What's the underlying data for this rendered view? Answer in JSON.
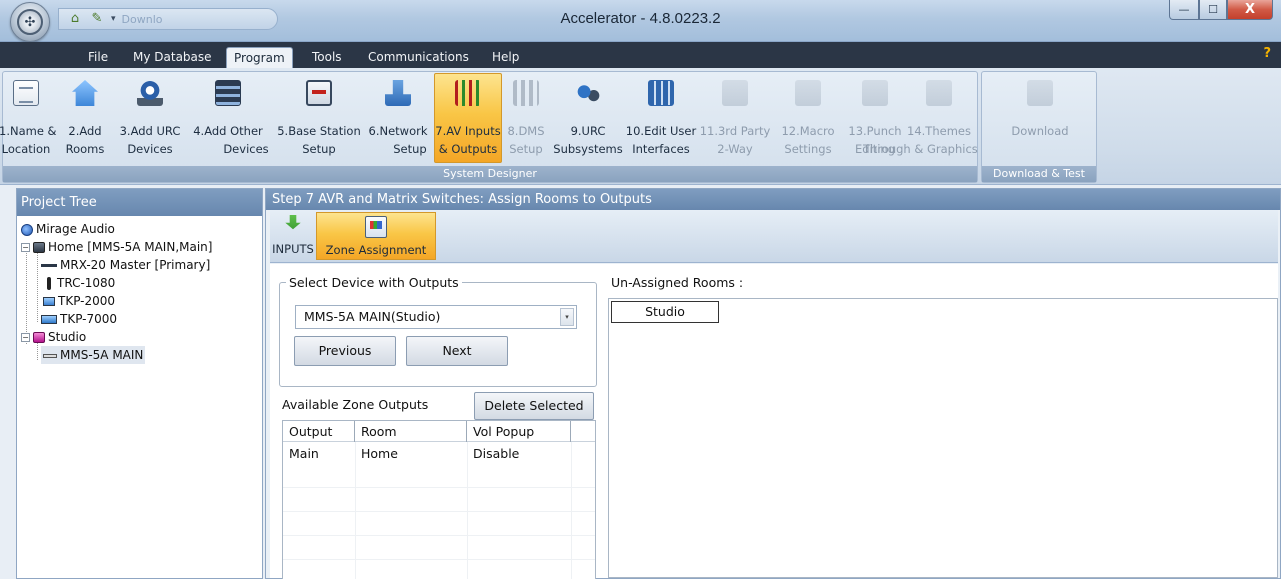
{
  "window": {
    "title": "Accelerator - 4.8.0223.2",
    "qat_ghost_text": "Downlo",
    "controls": {
      "minimize": "—",
      "maximize": "☐",
      "close": "X"
    }
  },
  "menu": {
    "tabs": [
      "File",
      "My Database",
      "Program",
      "Tools",
      "Communications",
      "Help"
    ],
    "active": "Program",
    "help_glyph": "?"
  },
  "ribbon": {
    "groups": [
      {
        "label": "System Designer",
        "buttons": [
          {
            "line1": "1.Name &",
            "line2": "Location",
            "icon": "document-icon",
            "state": "enabled"
          },
          {
            "line1": "2.Add",
            "line2": "Rooms",
            "icon": "house-icon",
            "state": "enabled"
          },
          {
            "line1": "3.Add URC",
            "line2": "Devices",
            "icon": "urc-device-icon",
            "state": "enabled"
          },
          {
            "line1": "4.Add Other",
            "line2": "Devices",
            "icon": "rack-icon",
            "state": "enabled"
          },
          {
            "line1": "5.Base Station",
            "line2": "Setup",
            "icon": "base-station-icon",
            "state": "enabled"
          },
          {
            "line1": "6.Network",
            "line2": "Setup",
            "icon": "network-icon",
            "state": "enabled"
          },
          {
            "line1": "7.AV Inputs",
            "line2": "& Outputs",
            "icon": "av-cables-icon",
            "state": "active"
          },
          {
            "line1": "8.DMS",
            "line2": "Setup",
            "icon": "dms-icon",
            "state": "disabled"
          },
          {
            "line1": "9.URC",
            "line2": "Subsystems",
            "icon": "subsystems-icon",
            "state": "enabled"
          },
          {
            "line1": "10.Edit User",
            "line2": "Interfaces",
            "icon": "interface-grid-icon",
            "state": "enabled"
          },
          {
            "line1": "11.3rd Party",
            "line2": "2-Way",
            "icon": "two-way-icon",
            "state": "disabled"
          },
          {
            "line1": "12.Macro",
            "line2": "Settings",
            "icon": "macro-icon",
            "state": "disabled"
          },
          {
            "line1": "13.Punch",
            "line2": "Editing",
            "icon": "punch-through-icon",
            "state": "disabled"
          },
          {
            "line1": "14.Themes",
            "line2": "Through & Graphics",
            "icon": "themes-icon",
            "state": "disabled"
          }
        ]
      },
      {
        "label": "Download & Test",
        "buttons": [
          {
            "line1": "Download",
            "line2": "",
            "icon": "download-icon",
            "state": "disabled"
          }
        ]
      }
    ]
  },
  "project_tree": {
    "header": "Project Tree",
    "nodes": [
      {
        "label": "Mirage Audio",
        "level": 0,
        "icon": "globe-icon"
      },
      {
        "label": "Home [MMS-5A MAIN,Main]",
        "level": 1,
        "icon": "room-icon",
        "expander": "−"
      },
      {
        "label": "MRX-20 Master [Primary]",
        "level": 2,
        "icon": "controller-icon"
      },
      {
        "label": "TRC-1080",
        "level": 2,
        "icon": "remote-icon"
      },
      {
        "label": "TKP-2000",
        "level": 2,
        "icon": "keypad-icon"
      },
      {
        "label": "TKP-7000",
        "level": 2,
        "icon": "touchscreen-icon"
      },
      {
        "label": "Studio",
        "level": 1,
        "icon": "room-icon",
        "expander": "−"
      },
      {
        "label": "MMS-5A MAIN",
        "level": 2,
        "icon": "media-server-icon",
        "selected": true
      }
    ]
  },
  "main": {
    "step_title": "Step 7 AVR and Matrix Switches: Assign Rooms to Outputs",
    "subtabs": [
      {
        "label": "INPUTS",
        "icon": "inputs-icon",
        "active": false
      },
      {
        "label": "Zone Assignment",
        "icon": "zone-assignment-icon",
        "active": true
      }
    ],
    "select_device": {
      "legend": "Select Device with Outputs",
      "value": "MMS-5A MAIN(Studio)",
      "previous_label": "Previous",
      "next_label": "Next"
    },
    "zone_outputs": {
      "label": "Available Zone Outputs",
      "delete_label": "Delete Selected",
      "columns": [
        "Output",
        "Room",
        "Vol Popup"
      ],
      "rows": [
        {
          "output": "Main",
          "room": "Home",
          "vol_popup": "Disable"
        }
      ]
    },
    "unassigned": {
      "label": "Un-Assigned Rooms :",
      "rooms": [
        "Studio"
      ]
    }
  }
}
